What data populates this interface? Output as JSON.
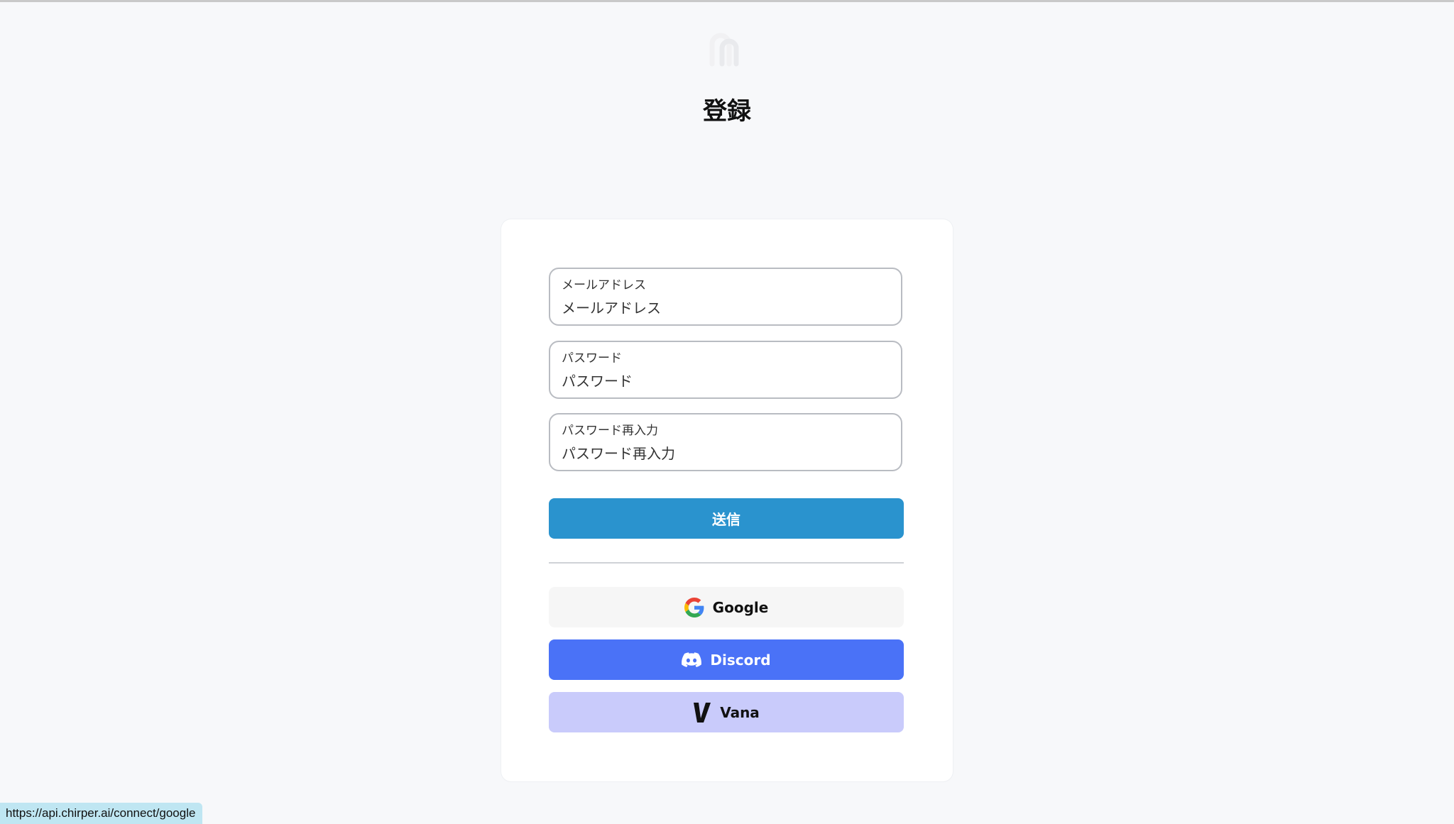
{
  "page": {
    "title": "登録"
  },
  "form": {
    "email": {
      "label": "メールアドレス",
      "placeholder": "メールアドレス",
      "value": ""
    },
    "password": {
      "label": "パスワード",
      "placeholder": "パスワード",
      "value": ""
    },
    "password_confirm": {
      "label": "パスワード再入力",
      "placeholder": "パスワード再入力",
      "value": ""
    },
    "submit_label": "送信"
  },
  "oauth": {
    "google": {
      "label": "Google",
      "icon": "google-icon",
      "background": "#f6f6f6"
    },
    "discord": {
      "label": "Discord",
      "icon": "discord-icon",
      "background": "#4a72f7"
    },
    "vana": {
      "label": "Vana",
      "icon": "vana-icon",
      "background": "#c9cbfb"
    }
  },
  "colors": {
    "submit": "#2a93ce",
    "page_background": "#f7f8fa"
  },
  "status_bar": {
    "url": "https://api.chirper.ai/connect/google"
  }
}
